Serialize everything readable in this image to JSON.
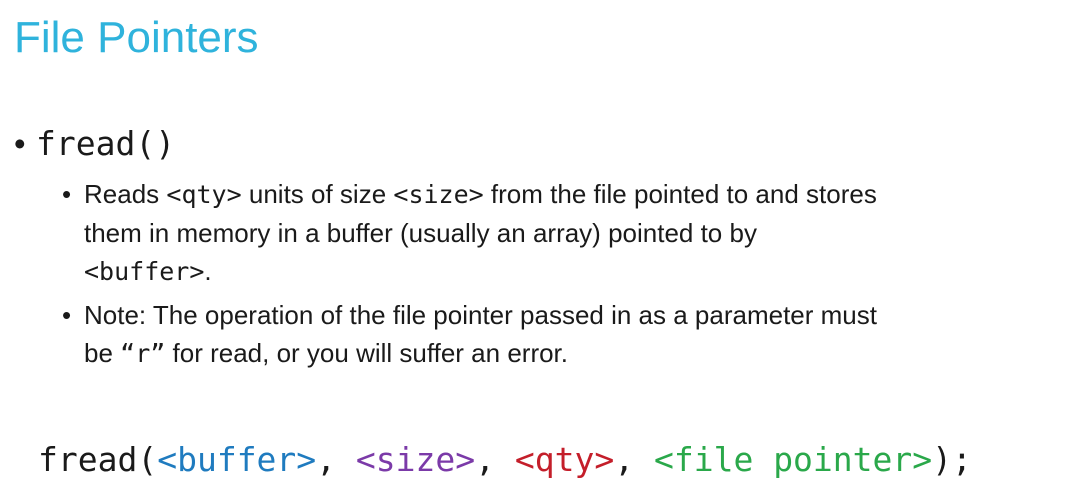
{
  "slide": {
    "title": "File Pointers",
    "title_color": "#2fb3dc",
    "bullet": {
      "marker": "•",
      "code": "fread()"
    },
    "sub_bullets": [
      {
        "marker": "•",
        "line1_a": "Reads ",
        "line1_qty": "<qty>",
        "line1_b": " units of size ",
        "line1_size": "<size>",
        "line1_c": " from the file pointed to and stores",
        "line2": "them in memory in a buffer (usually an array) pointed to by",
        "line3_buffer": "<buffer>",
        "line3_end": "."
      },
      {
        "marker": "•",
        "line1": "Note: The operation of the file pointer passed in as a parameter must",
        "line2_a": "be ",
        "line2_r": "“r”",
        "line2_b": " for read, or you will suffer an error."
      }
    ],
    "code_line": {
      "fn": "fread(",
      "buffer": "<buffer>",
      "sep1": ", ",
      "size": "<size>",
      "sep2": ", ",
      "qty": "<qty>",
      "sep3": ", ",
      "file_pointer": "<file pointer>",
      "end": ");"
    },
    "colors": {
      "buffer": "#1f7bbf",
      "size": "#7b3aa8",
      "qty": "#c41e2a",
      "file_pointer": "#2aa84a",
      "text": "#1a1a1a"
    }
  }
}
